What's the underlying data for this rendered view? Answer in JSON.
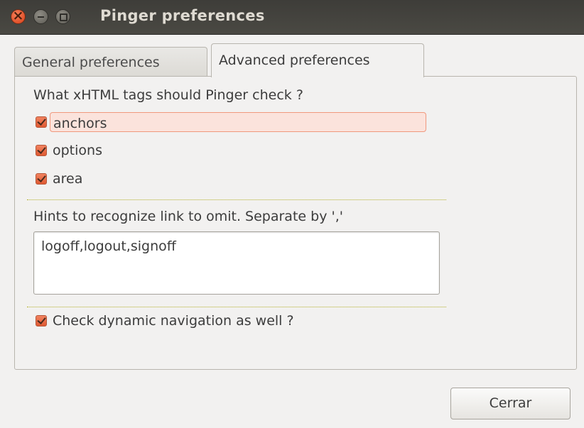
{
  "window": {
    "title": "Pinger preferences",
    "controls": [
      "close-icon",
      "minimize-icon",
      "maximize-icon"
    ]
  },
  "tabs": [
    {
      "label": "General preferences",
      "active": false
    },
    {
      "label": "Advanced preferences",
      "active": true
    }
  ],
  "advanced": {
    "tags_question": "What xHTML tags should Pinger check ?",
    "tags": [
      {
        "label": "anchors",
        "checked": true,
        "focused": true
      },
      {
        "label": "options",
        "checked": true,
        "focused": false
      },
      {
        "label": "area",
        "checked": true,
        "focused": false
      }
    ],
    "hints_label": "Hints to recognize link to omit. Separate by ','",
    "hints_value": "logoff,logout,signoff",
    "dynamic_nav": {
      "label": "Check dynamic navigation as well ?",
      "checked": true
    }
  },
  "footer": {
    "close_label": "Cerrar"
  },
  "colors": {
    "accent": "#df5a32",
    "titlebar": "#3e3d39",
    "background": "#f2f1f0"
  }
}
